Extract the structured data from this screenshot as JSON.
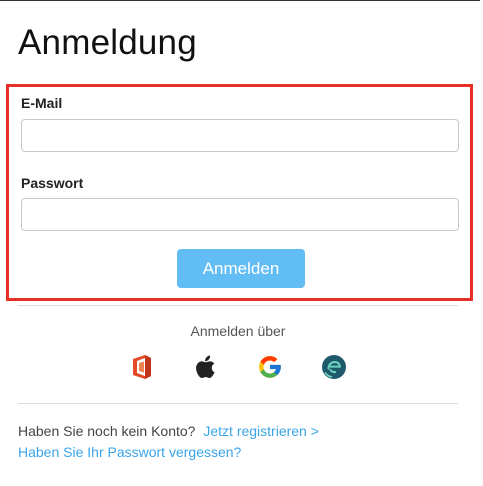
{
  "page": {
    "title": "Anmeldung"
  },
  "form": {
    "email_label": "E-Mail",
    "email_value": "",
    "email_placeholder": "",
    "password_label": "Passwort",
    "password_value": "",
    "password_placeholder": "",
    "submit_label": "Anmelden",
    "highlight_color": "#e53027",
    "button_color": "#63bdf5"
  },
  "sso": {
    "heading": "Anmelden über",
    "providers": [
      {
        "name": "office",
        "icon": "microsoft-office-icon"
      },
      {
        "name": "apple",
        "icon": "apple-icon"
      },
      {
        "name": "google",
        "icon": "google-icon"
      },
      {
        "name": "element",
        "icon": "element-icon"
      }
    ]
  },
  "footer": {
    "no_account_text": "Haben Sie noch kein Konto?",
    "register_link": "Jetzt registrieren >",
    "forgot_password_link": "Haben Sie Ihr Passwort vergessen?",
    "link_color": "#3aa4e8"
  }
}
